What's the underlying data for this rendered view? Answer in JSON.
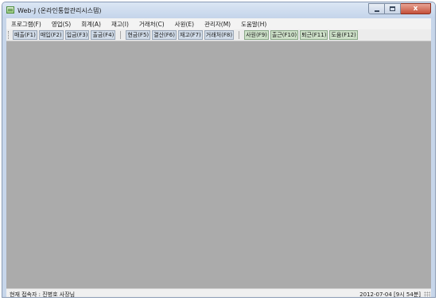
{
  "window": {
    "title": "Web-J (온라인통합관리시스템)",
    "close_glyph": "x"
  },
  "menu": {
    "items": [
      {
        "label": "프로그램(F)"
      },
      {
        "label": "영업(S)"
      },
      {
        "label": "회계(A)"
      },
      {
        "label": "재고(I)"
      },
      {
        "label": "거래처(C)"
      },
      {
        "label": "사원(E)"
      },
      {
        "label": "관리자(M)"
      },
      {
        "label": "도움말(H)"
      }
    ]
  },
  "toolbar": {
    "group1": [
      {
        "label": "매출(F1)"
      },
      {
        "label": "매입(F2)"
      },
      {
        "label": "입금(F3)"
      },
      {
        "label": "출금(F4)"
      }
    ],
    "group2": [
      {
        "label": "현금(F5)"
      },
      {
        "label": "결산(F6)"
      },
      {
        "label": "재고(F7)"
      },
      {
        "label": "거래처(F8)"
      }
    ],
    "group3": [
      {
        "label": "사원(F9)"
      },
      {
        "label": "출근(F10)"
      },
      {
        "label": "퇴근(F11)"
      },
      {
        "label": "도움(F12)"
      }
    ]
  },
  "status": {
    "user": "현재 접속자 : 진병호 사장님",
    "datetime": "2012-07-04 [9시 54분]"
  },
  "colors": {
    "workspace_bg": "#ababab",
    "toolbar_blue": "#d0dbe8",
    "toolbar_green": "#cde0c8",
    "close_red": "#c4503a"
  }
}
